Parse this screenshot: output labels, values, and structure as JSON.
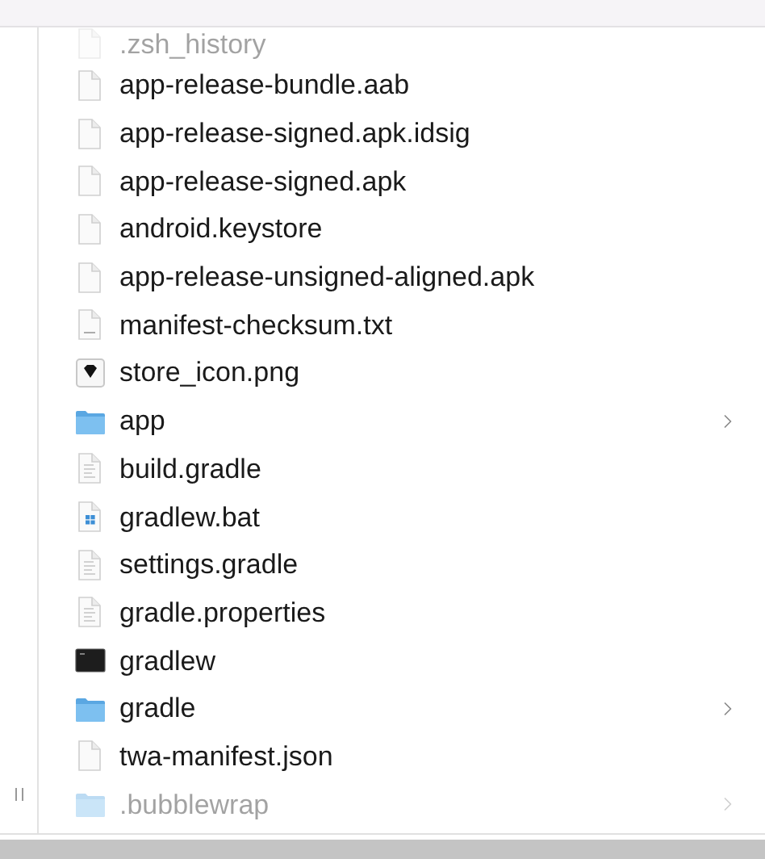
{
  "files": [
    {
      "name": ".zsh_history",
      "kind": "document",
      "hidden": true,
      "expandable": false
    },
    {
      "name": "app-release-bundle.aab",
      "kind": "document",
      "hidden": false,
      "expandable": false
    },
    {
      "name": "app-release-signed.apk.idsig",
      "kind": "document",
      "hidden": false,
      "expandable": false
    },
    {
      "name": "app-release-signed.apk",
      "kind": "document",
      "hidden": false,
      "expandable": false
    },
    {
      "name": "android.keystore",
      "kind": "document",
      "hidden": false,
      "expandable": false
    },
    {
      "name": "app-release-unsigned-aligned.apk",
      "kind": "document",
      "hidden": false,
      "expandable": false
    },
    {
      "name": "manifest-checksum.txt",
      "kind": "txt",
      "hidden": false,
      "expandable": false
    },
    {
      "name": "store_icon.png",
      "kind": "image",
      "hidden": false,
      "expandable": false
    },
    {
      "name": "app",
      "kind": "folder",
      "hidden": false,
      "expandable": true
    },
    {
      "name": "build.gradle",
      "kind": "text",
      "hidden": false,
      "expandable": false
    },
    {
      "name": "gradlew.bat",
      "kind": "windows",
      "hidden": false,
      "expandable": false
    },
    {
      "name": "settings.gradle",
      "kind": "text",
      "hidden": false,
      "expandable": false
    },
    {
      "name": "gradle.properties",
      "kind": "text",
      "hidden": false,
      "expandable": false
    },
    {
      "name": "gradlew",
      "kind": "terminal",
      "hidden": false,
      "expandable": false
    },
    {
      "name": "gradle",
      "kind": "folder",
      "hidden": false,
      "expandable": true
    },
    {
      "name": "twa-manifest.json",
      "kind": "document",
      "hidden": false,
      "expandable": false
    },
    {
      "name": ".bubblewrap",
      "kind": "folder",
      "hidden": true,
      "expandable": true
    }
  ]
}
